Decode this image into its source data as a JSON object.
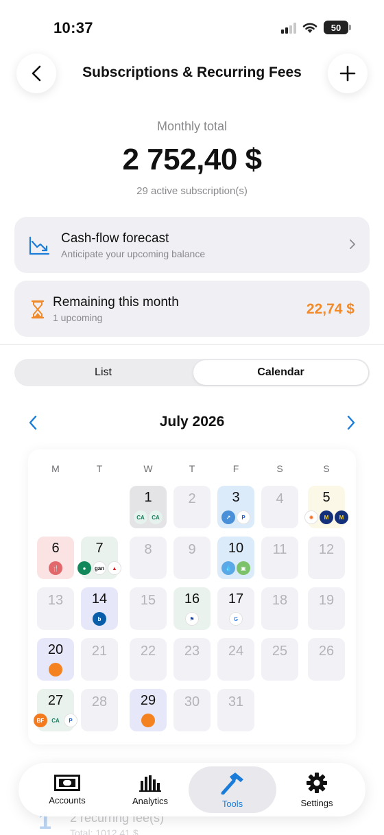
{
  "status_bar": {
    "time": "10:37",
    "battery": "50"
  },
  "header": {
    "title": "Subscriptions & Recurring Fees",
    "back_icon": "chevron-left-icon",
    "add_icon": "plus-icon"
  },
  "summary": {
    "label": "Monthly total",
    "value": "2 752,40 $",
    "active_count": "29 active subscription(s)"
  },
  "forecast_card": {
    "title": "Cash-flow forecast",
    "subtitle": "Anticipate your upcoming balance",
    "icon": "trend-down-chart-icon",
    "accent": "#1a7bd8"
  },
  "remaining_card": {
    "title": "Remaining this month",
    "subtitle": "1 upcoming",
    "value": "22,74 $",
    "icon": "hourglass-icon",
    "accent": "#f08a2b"
  },
  "view_toggle": {
    "options": [
      "List",
      "Calendar"
    ],
    "selected": "Calendar"
  },
  "calendar": {
    "month": "July 2026",
    "weekdays": [
      "M",
      "T",
      "W",
      "T",
      "F",
      "S",
      "S"
    ],
    "days": [
      {
        "n": "1",
        "col": 2,
        "row": 0,
        "bg": "#e4e4e6",
        "logos": [
          "credit-agricole",
          "credit-agricole"
        ]
      },
      {
        "n": "2",
        "col": 3,
        "row": 0
      },
      {
        "n": "3",
        "col": 4,
        "row": 0,
        "bg": "#dcebfa",
        "logos": [
          "chart-app",
          "paypal"
        ]
      },
      {
        "n": "4",
        "col": 5,
        "row": 0
      },
      {
        "n": "5",
        "col": 6,
        "row": 0,
        "bg": "#fcf8e8",
        "logos": [
          "edf",
          "macif",
          "macif"
        ]
      },
      {
        "n": "6",
        "col": 0,
        "row": 1,
        "bg": "#fbe3e3",
        "logos": [
          "restaurant"
        ]
      },
      {
        "n": "7",
        "col": 1,
        "row": 1,
        "bg": "#e9f2ec",
        "logos": [
          "bnp",
          "gan",
          "allianz"
        ]
      },
      {
        "n": "8",
        "col": 2,
        "row": 1
      },
      {
        "n": "9",
        "col": 3,
        "row": 1
      },
      {
        "n": "10",
        "col": 4,
        "row": 1,
        "bg": "#dcebfa",
        "logos": [
          "water",
          "android"
        ]
      },
      {
        "n": "11",
        "col": 5,
        "row": 1
      },
      {
        "n": "12",
        "col": 6,
        "row": 1
      },
      {
        "n": "13",
        "col": 0,
        "row": 2
      },
      {
        "n": "14",
        "col": 1,
        "row": 2,
        "bg": "#e7e7fa",
        "logos": [
          "bouygues"
        ]
      },
      {
        "n": "15",
        "col": 2,
        "row": 2
      },
      {
        "n": "16",
        "col": 3,
        "row": 2,
        "bg": "#e9f2ec",
        "logos": [
          "tax-france"
        ]
      },
      {
        "n": "17",
        "col": 4,
        "row": 2,
        "bg": "#f2f2f6",
        "logos": [
          "google"
        ]
      },
      {
        "n": "18",
        "col": 5,
        "row": 2
      },
      {
        "n": "19",
        "col": 6,
        "row": 2
      },
      {
        "n": "20",
        "col": 0,
        "row": 3,
        "bg": "#e7e7fa",
        "logos": [
          "orange"
        ]
      },
      {
        "n": "21",
        "col": 1,
        "row": 3
      },
      {
        "n": "22",
        "col": 2,
        "row": 3
      },
      {
        "n": "23",
        "col": 3,
        "row": 3
      },
      {
        "n": "24",
        "col": 4,
        "row": 3
      },
      {
        "n": "25",
        "col": 5,
        "row": 3
      },
      {
        "n": "26",
        "col": 6,
        "row": 3
      },
      {
        "n": "27",
        "col": 0,
        "row": 4,
        "bg": "#e9f2ec",
        "logos": [
          "basic-fit",
          "credit-agricole",
          "paypal"
        ]
      },
      {
        "n": "28",
        "col": 1,
        "row": 4
      },
      {
        "n": "29",
        "col": 2,
        "row": 4,
        "bg": "#e7e7fa",
        "logos": [
          "orange"
        ]
      },
      {
        "n": "30",
        "col": 3,
        "row": 4
      },
      {
        "n": "31",
        "col": 4,
        "row": 4
      }
    ]
  },
  "list_peek": {
    "number": "1",
    "title": "2 recurring fee(s)",
    "subtitle": "Total: 1012,41 $"
  },
  "tabbar": {
    "items": [
      {
        "label": "Accounts",
        "icon": "banknote-icon"
      },
      {
        "label": "Analytics",
        "icon": "bar-chart-icon"
      },
      {
        "label": "Tools",
        "icon": "hammer-icon"
      },
      {
        "label": "Settings",
        "icon": "gear-icon"
      }
    ],
    "active": "Tools"
  }
}
